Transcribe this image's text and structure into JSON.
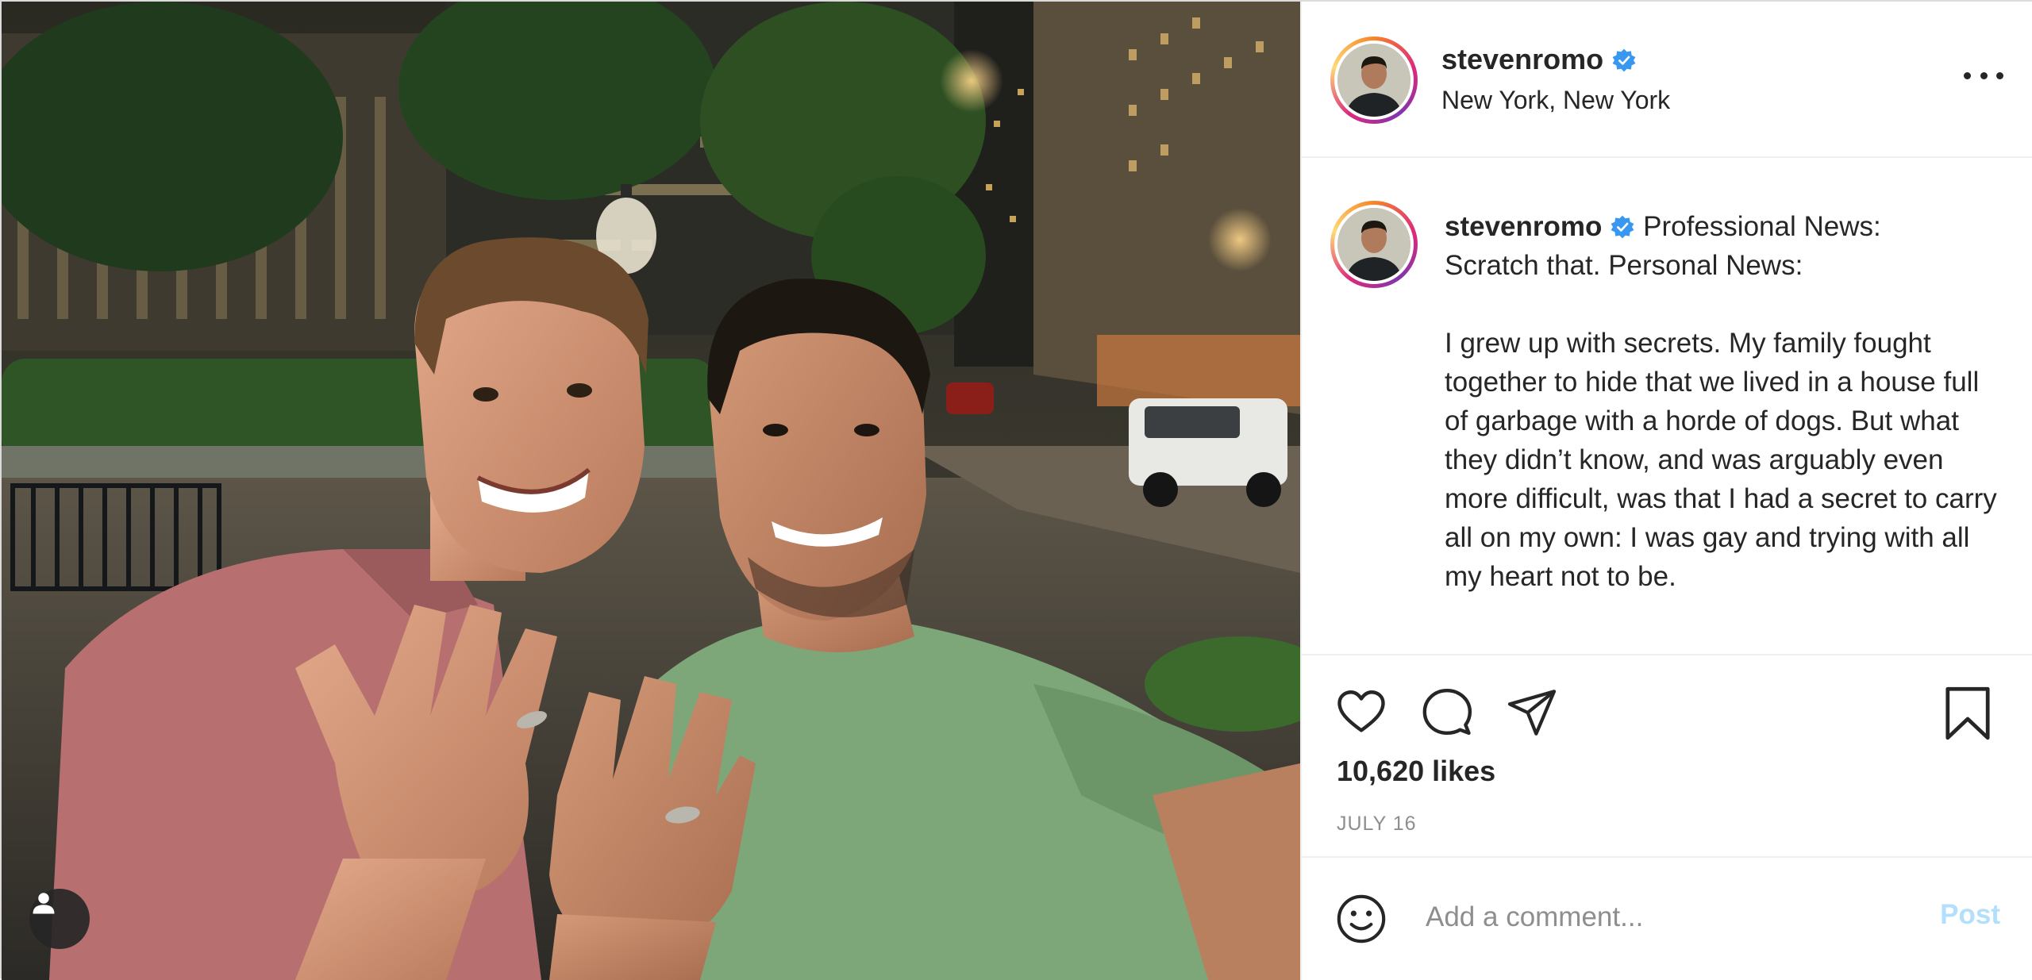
{
  "post": {
    "username": "stevenromo",
    "location": "New York, New York",
    "caption_lead": "Professional News:\nScratch that. Personal News:",
    "caption_body": "I grew up with secrets. My family fought together to hide that we lived in a house full of garbage with a horde of dogs. But what they didn’t know, and was arguably even more difficult, was that I had a secret to carry all on my own: I was gay and trying with all my heart not to be.",
    "likes": "10,620 likes",
    "date": "JULY 16"
  },
  "comment": {
    "placeholder": "Add a comment...",
    "post_label": "Post"
  },
  "icons": {
    "verified": "verified-badge-icon",
    "more": "more-options-icon",
    "like": "heart-icon",
    "comment": "comment-icon",
    "share": "paper-plane-icon",
    "save": "bookmark-icon",
    "tag": "user-tag-icon",
    "emoji": "smiley-icon"
  },
  "colors": {
    "verified": "#3897f0",
    "post_button": "#b2dffc",
    "muted": "#8e8e8e"
  }
}
